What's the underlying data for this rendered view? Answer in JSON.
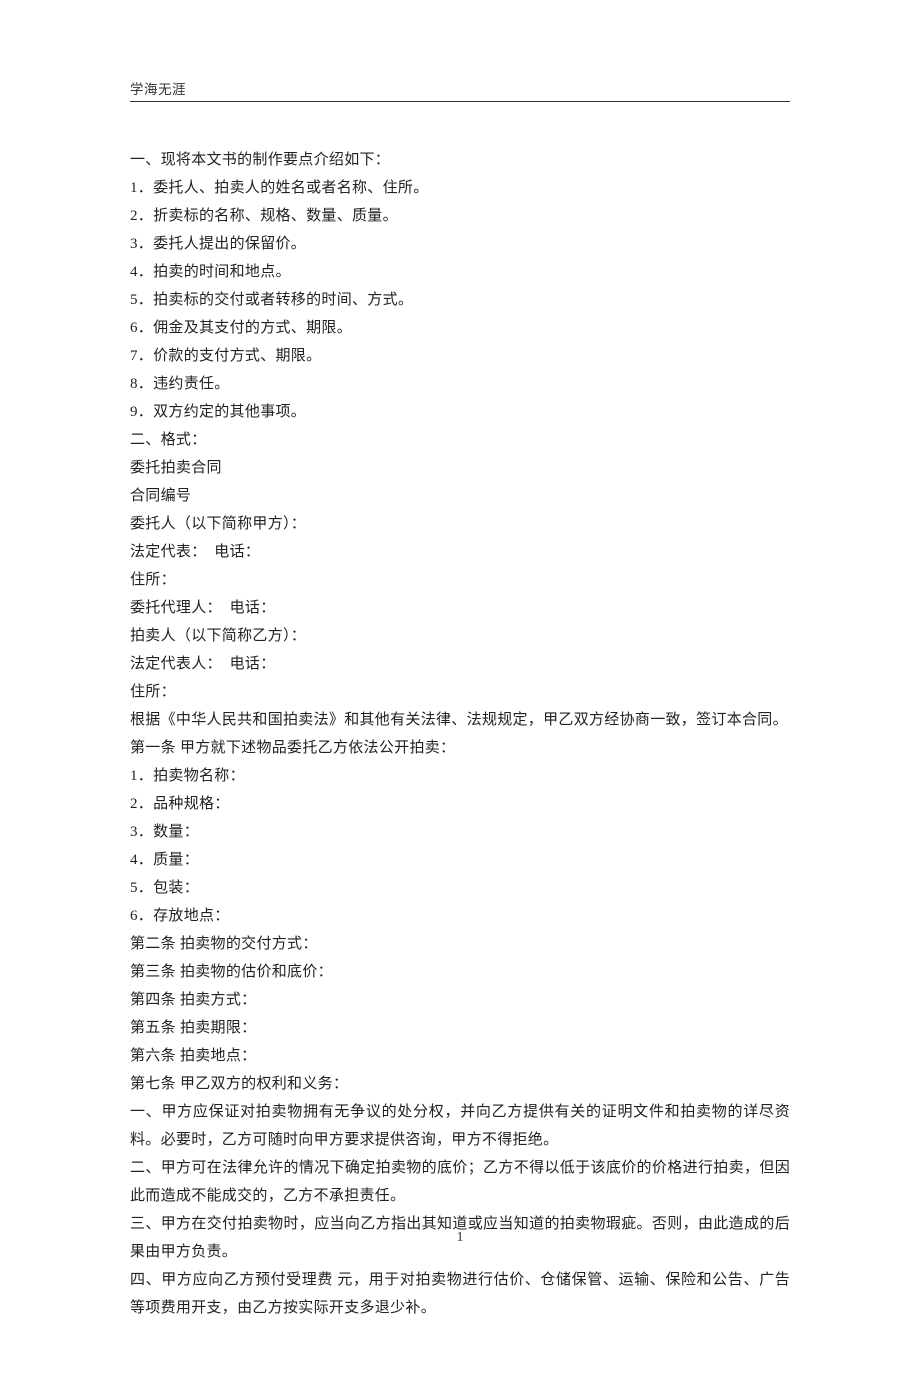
{
  "header": "学海无涯",
  "pageNumber": "1",
  "lines": [
    "一、现将本文书的制作要点介绍如下：",
    "1．委托人、拍卖人的姓名或者名称、住所。",
    "2．折卖标的名称、规格、数量、质量。",
    "3．委托人提出的保留价。",
    "4．拍卖的时间和地点。",
    "5．拍卖标的交付或者转移的时间、方式。",
    "6．佣金及其支付的方式、期限。",
    "7．价款的支付方式、期限。",
    "8．违约责任。",
    "9．双方约定的其他事项。",
    "二、格式：",
    "委托拍卖合同",
    "合同编号",
    "委托人（以下简称甲方）：",
    "法定代表：　电话：",
    "住所：",
    "委托代理人：　电话：",
    "拍卖人（以下简称乙方）：",
    "法定代表人：　电话：",
    "住所：",
    "根据《中华人民共和国拍卖法》和其他有关法律、法规规定，甲乙双方经协商一致，签订本合同。",
    "第一条 甲方就下述物品委托乙方依法公开拍卖：",
    "1．拍卖物名称：",
    "2．品种规格：",
    "3．数量：",
    "4．质量：",
    "5．包装：",
    "6．存放地点：",
    "第二条 拍卖物的交付方式：",
    "第三条 拍卖物的估价和底价：",
    "第四条 拍卖方式：",
    "第五条 拍卖期限：",
    "第六条 拍卖地点：",
    "第七条 甲乙双方的权利和义务：",
    "一、甲方应保证对拍卖物拥有无争议的处分权，并向乙方提供有关的证明文件和拍卖物的详尽资料。必要时，乙方可随时向甲方要求提供咨询，甲方不得拒绝。",
    "二、甲方可在法律允许的情况下确定拍卖物的底价；乙方不得以低于该底价的价格进行拍卖，但因此而造成不能成交的，乙方不承担责任。",
    "三、甲方在交付拍卖物时，应当向乙方指出其知道或应当知道的拍卖物瑕疵。否则，由此造成的后果由甲方负责。",
    "四、甲方应向乙方预付受理费 元，用于对拍卖物进行估价、仓储保管、运输、保险和公告、广告等项费用开支，由乙方按实际开支多退少补。"
  ]
}
